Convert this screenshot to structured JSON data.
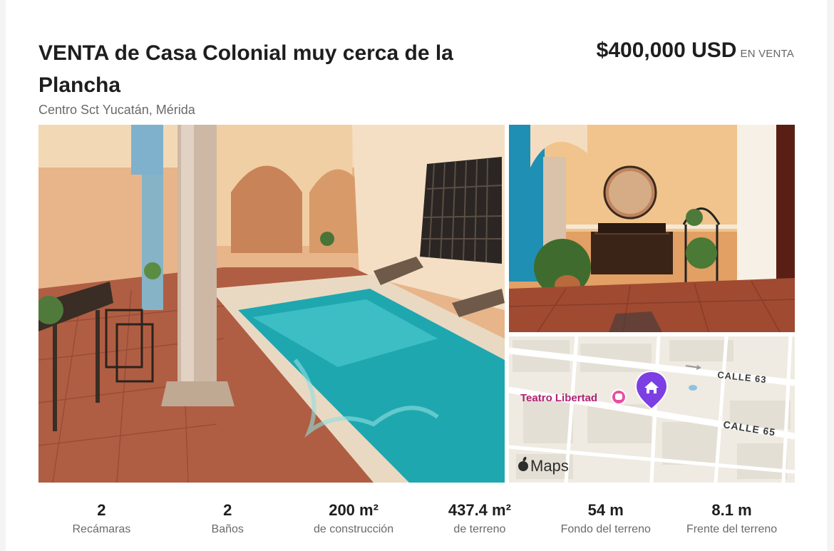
{
  "listing": {
    "title": "VENTA de Casa Colonial muy cerca de la Plancha",
    "price": "$400,000 USD",
    "status": "EN VENTA",
    "location": "Centro Sct Yucatán, Mérida"
  },
  "gallery": {
    "main_photo": "patio-pool-photo",
    "side_photo": "entry-hall-photo"
  },
  "map": {
    "street_1": "CALLE 63",
    "street_2": "CALLE 65",
    "poi": "Teatro Libertad",
    "brand": "Maps",
    "pin_icon": "house-pin-icon"
  },
  "stats": [
    {
      "value": "2",
      "label": "Recámaras"
    },
    {
      "value": "2",
      "label": "Baños"
    },
    {
      "value": "200 m²",
      "label": "de construcción"
    },
    {
      "value": "437.4 m²",
      "label": "de terreno"
    },
    {
      "value": "54 m",
      "label": "Fondo del terreno"
    },
    {
      "value": "8.1 m",
      "label": "Frente del terreno"
    }
  ],
  "colors": {
    "pool": "#1fa7b0",
    "terracotta": "#a8523a",
    "wall": "#e9b384",
    "map_pin": "#7b3fe4",
    "poi": "#b02277"
  }
}
